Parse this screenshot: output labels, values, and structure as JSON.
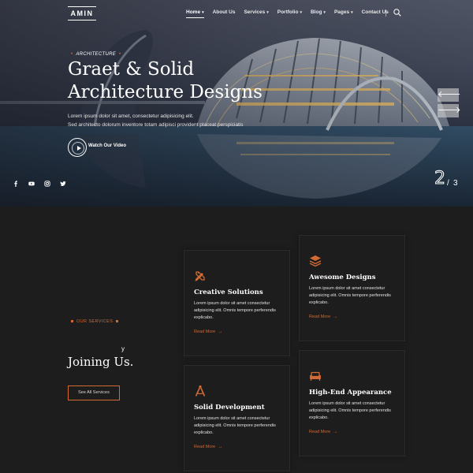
{
  "brand": {
    "logo_text": "AMIN"
  },
  "nav": {
    "items": [
      {
        "label": "Home",
        "has_caret": true,
        "active": true
      },
      {
        "label": "About Us",
        "has_caret": false
      },
      {
        "label": "Services",
        "has_caret": true
      },
      {
        "label": "Portfolio",
        "has_caret": true
      },
      {
        "label": "Blog",
        "has_caret": true
      },
      {
        "label": "Pages",
        "has_caret": true
      },
      {
        "label": "Contact Us",
        "has_caret": false
      }
    ],
    "search_icon": "search-icon"
  },
  "hero": {
    "eyebrow": "ARCHITECTURE",
    "title_line1": "Graet & Solid",
    "title_line2": "Architecture Designs",
    "sub_line1": "Lorem ipsum dolor sit amet, consectetur adipisicing elit.",
    "sub_line2": "Sed architecto dolorum inventore totam adipisci provident placeat perspiciatis",
    "video_label": "Watch Our Video",
    "prev_label": "🡐",
    "next_label": "🡒",
    "slide_current": "2",
    "slide_separator": "/",
    "slide_total": "3",
    "socials": [
      "facebook-icon",
      "youtube-icon",
      "instagram-icon",
      "twitter-icon"
    ]
  },
  "services": {
    "eyebrow": "OUR SERVICES",
    "heading_fragment": "y",
    "heading": "Joining Us.",
    "see_all": "See All Services",
    "cards": [
      {
        "icon": "pencil-ruler-icon",
        "title": "Creative Solutions",
        "desc": "Lorem ipsum dolor sit amet consectetur adipisicing elit. Omnis tempore perferendis explicabo.",
        "more": "Read More"
      },
      {
        "icon": "layers-icon",
        "title": "Awesome Designs",
        "desc": "Lorem ipsum dolor sit amet consectetur adipisicing elit. Omnis tempore perferendis explicabo.",
        "more": "Read More"
      },
      {
        "icon": "compass-icon",
        "title": "Solid Development",
        "desc": "Lorem ipsum dolor sit amet consectetur adipisicing elit. Omnis tempore perferendis explicabo.",
        "more": "Read More"
      },
      {
        "icon": "sofa-icon",
        "title": "High-End Appearance",
        "desc": "Lorem ipsum dolor sit amet consectetur adipisicing elit. Omnis tempore perferendis explicabo.",
        "more": "Read More"
      }
    ]
  },
  "colors": {
    "accent": "#d16a35",
    "dark_bg": "#1d1d1d"
  }
}
